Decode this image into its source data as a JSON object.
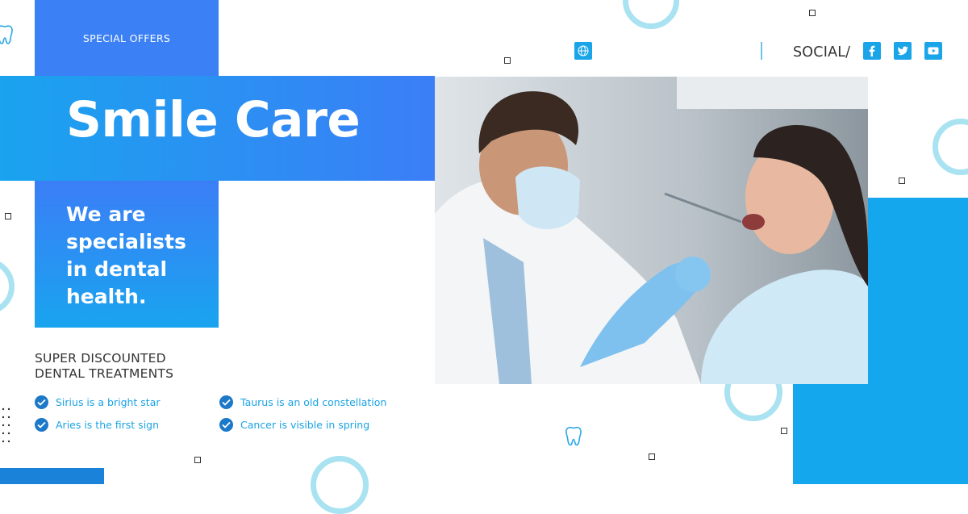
{
  "header": {
    "special_offers": "SPECIAL OFFERS"
  },
  "hero": {
    "title": "Smile Care",
    "tagline": "We are specialists in dental health."
  },
  "discount": {
    "heading_line1": "SUPER DISCOUNTED",
    "heading_line2": "DENTAL TREATMENTS"
  },
  "features": [
    "Sirius is a bright star",
    "Aries is the first sign",
    "Taurus is an old constellation",
    "Cancer is visible in spring"
  ],
  "social": {
    "label": "SOCIAL/",
    "icons": [
      "facebook-icon",
      "twitter-icon",
      "youtube-icon"
    ]
  },
  "colors": {
    "primary_blue": "#3b80f5",
    "sky_blue": "#1aa5e9",
    "ring": "#a9e2f1",
    "text_dark": "#333333",
    "check_blue": "#1c78c9",
    "feature_text": "#1ba3e4"
  },
  "icons": [
    "tooth-icon",
    "globe-icon",
    "check-icon"
  ]
}
